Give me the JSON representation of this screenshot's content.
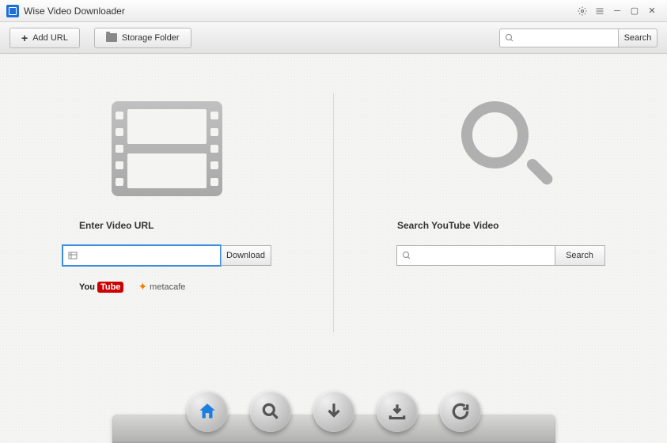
{
  "app": {
    "title": "Wise Video Downloader"
  },
  "toolbar": {
    "add_url_label": "Add URL",
    "storage_folder_label": "Storage Folder",
    "search_placeholder": "",
    "search_button": "Search"
  },
  "main": {
    "url_section_label": "Enter Video URL",
    "url_value": "",
    "download_button": "Download",
    "search_section_label": "Search YouTube Video",
    "search_value": "",
    "search_button": "Search",
    "providers": {
      "youtube_you": "You",
      "youtube_tube": "Tube",
      "metacafe": "metacafe"
    }
  },
  "dock": {
    "items": [
      "home",
      "search",
      "download",
      "downloads",
      "refresh"
    ]
  },
  "colors": {
    "accent": "#1e6fd6",
    "home_icon": "#1b7fe0"
  }
}
